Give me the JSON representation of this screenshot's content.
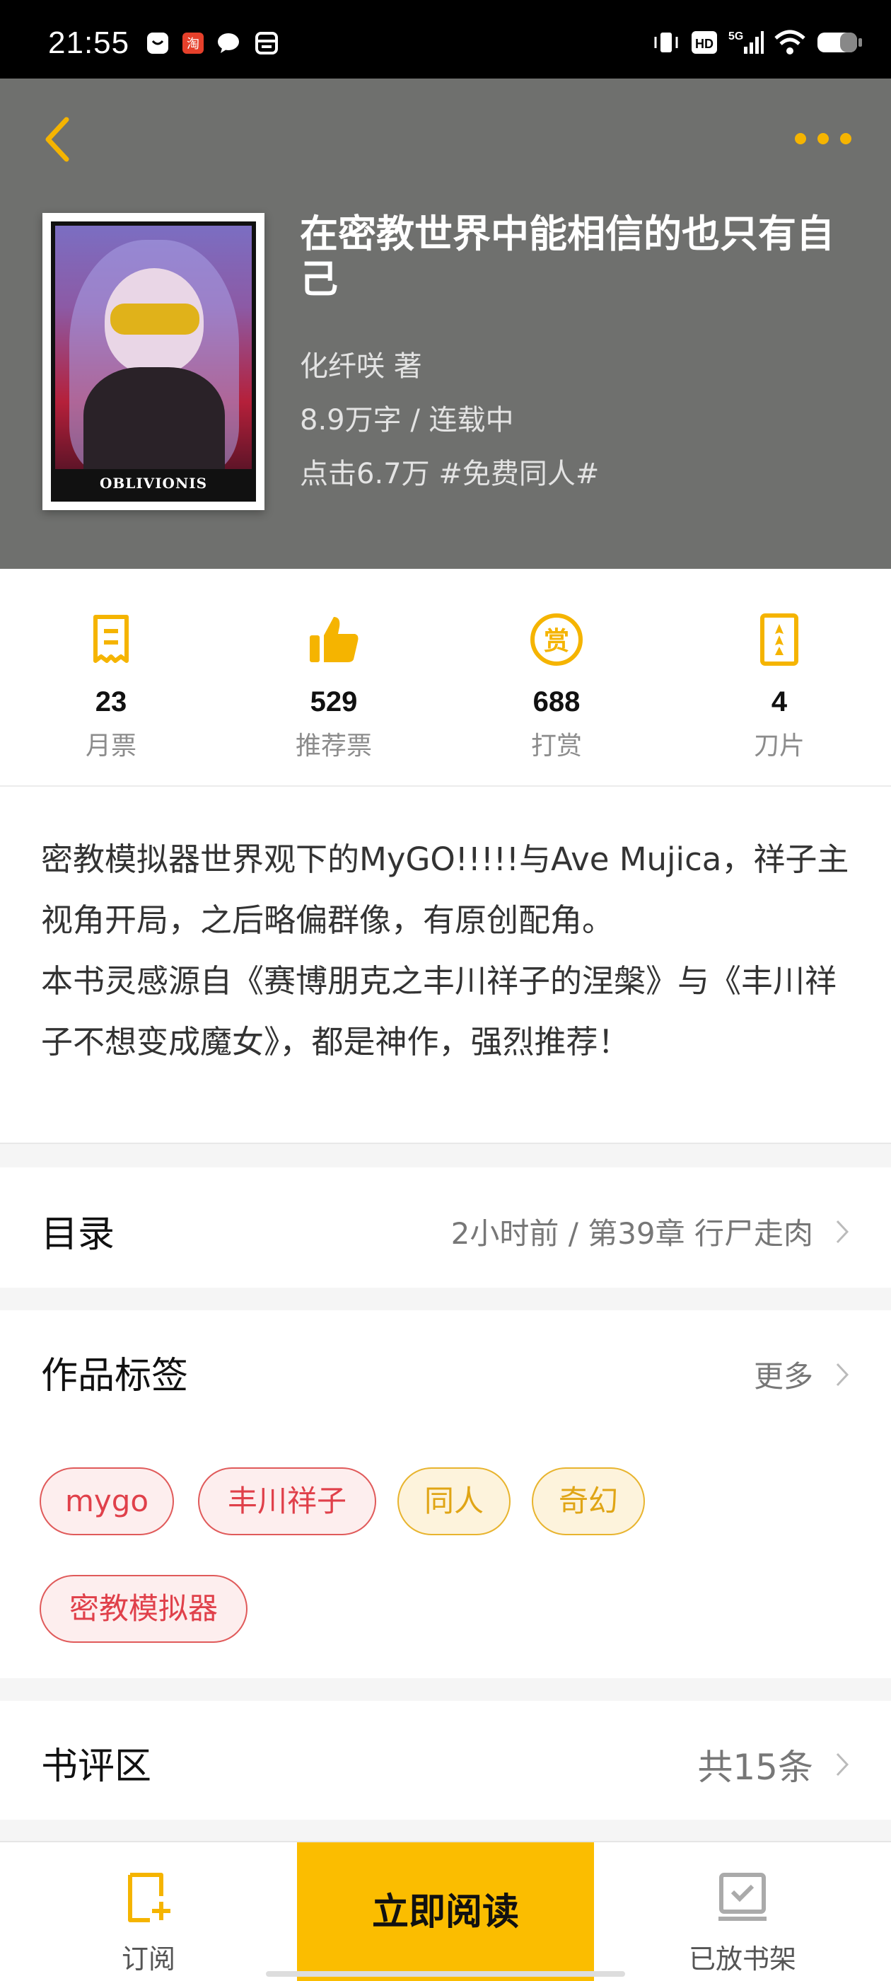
{
  "status_bar": {
    "time": "21:55",
    "network": "5G",
    "hd_label": "HD"
  },
  "header": {
    "back_icon": "chevron-left-icon",
    "more_icon": "ellipsis-icon",
    "accent_color": "#f5b400",
    "background": "#6f706e"
  },
  "book": {
    "cover_text": "OBLIVIONIS",
    "title": "在密教世界中能相信的也只有自己",
    "author": "化纤咲  著",
    "wordcount_status": "8.9万字 / 连载中",
    "clicks_tag": "点击6.7万  #免费同人#"
  },
  "stats": [
    {
      "value": "23",
      "label": "月票",
      "icon": "ticket-icon"
    },
    {
      "value": "529",
      "label": "推荐票",
      "icon": "thumbs-up-icon"
    },
    {
      "value": "688",
      "label": "打赏",
      "icon": "reward-coin-icon"
    },
    {
      "value": "4",
      "label": "刀片",
      "icon": "blade-icon"
    }
  ],
  "description": {
    "paragraph1": "密教模拟器世界观下的MyGO!!!!!与Ave Mujica，祥子主视角开局，之后略偏群像，有原创配角。",
    "paragraph2": "本书灵感源自《赛博朋克之丰川祥子的涅槃》与《丰川祥子不想变成魔女》，都是神作，强烈推荐！"
  },
  "catalog": {
    "title": "目录",
    "latest": "2小时前 / 第39章 行尸走肉"
  },
  "tags_section": {
    "title": "作品标签",
    "more": "更多",
    "tags": [
      {
        "label": "mygo",
        "style": "red"
      },
      {
        "label": "丰川祥子",
        "style": "red"
      },
      {
        "label": "同人",
        "style": "yellow"
      },
      {
        "label": "奇幻",
        "style": "yellow"
      },
      {
        "label": "密教模拟器",
        "style": "red"
      }
    ]
  },
  "reviews": {
    "title": "书评区",
    "count": "共15条"
  },
  "bottom_bar": {
    "subscribe_label": "订阅",
    "read_label": "立即阅读",
    "shelf_label": "已放书架",
    "read_color": "#fbbd00"
  }
}
